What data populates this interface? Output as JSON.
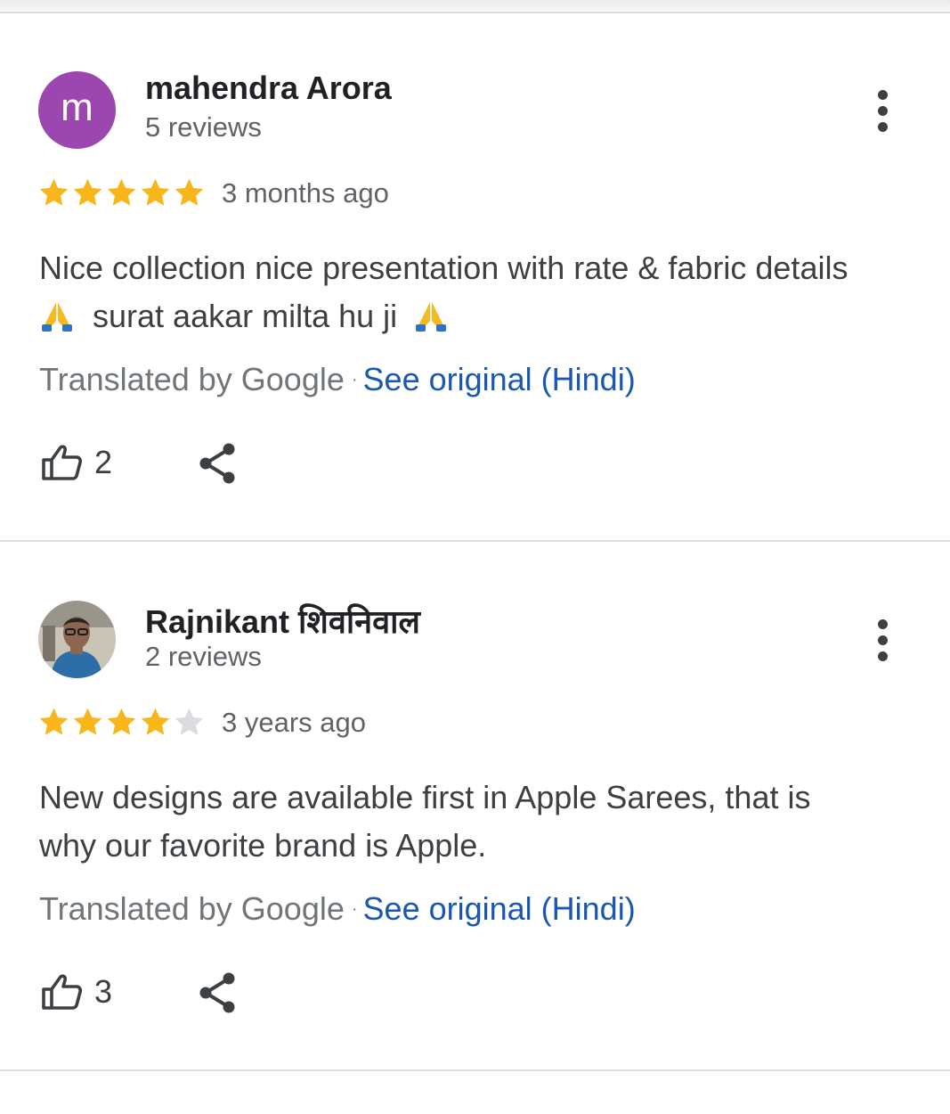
{
  "reviews": [
    {
      "author": "mahendra Arora",
      "avatar_letter": "m",
      "avatar_color": "#9c46b0",
      "reviews_count": "5 reviews",
      "rating": 5,
      "time": "3 months ago",
      "text_line1": "Nice collection nice presentation with rate & fabric details",
      "text_line2": "surat aakar milta hu ji",
      "translated_by": "Translated by Google",
      "separator": "·",
      "see_original": "See original (Hindi)",
      "likes": "2"
    },
    {
      "author": "Rajnikant शिवनिवाल",
      "avatar": "photo",
      "reviews_count": "2 reviews",
      "rating": 4,
      "time": "3 years ago",
      "text": "New designs are available first in Apple Sarees, that is why our favorite brand is Apple.",
      "translated_by": "Translated by Google",
      "separator": "·",
      "see_original": "See original (Hindi)",
      "likes": "3"
    }
  ],
  "icons": {
    "star_filled_color": "#f9b61a",
    "star_empty_color": "#dadce0",
    "link_color": "#1a57b0",
    "more": "more-vert-icon",
    "like": "thumb-up-icon",
    "share": "share-icon",
    "emoji": "folded-hands-emoji"
  }
}
